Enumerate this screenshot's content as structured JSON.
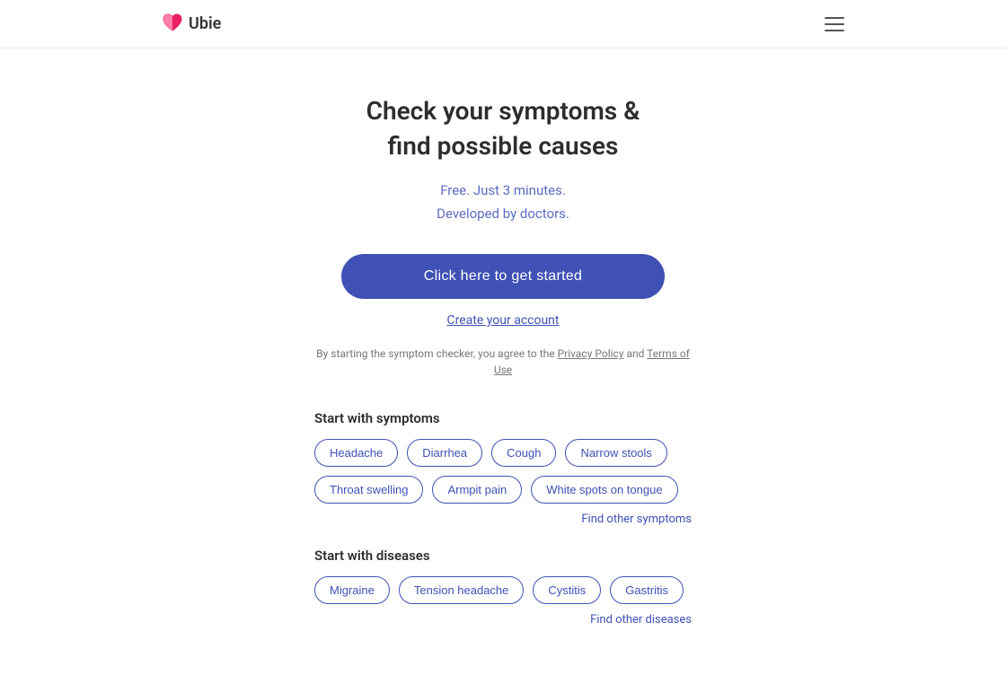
{
  "header": {
    "logo_text": "Ubie",
    "hamburger_label": "Menu"
  },
  "hero": {
    "headline_line1": "Check your symptoms &",
    "headline_line2": "find possible causes",
    "subtext_line1": "Free. Just 3 minutes.",
    "subtext_line2": "Developed by doctors.",
    "cta_label": "Click here to get started",
    "create_account_label": "Create your account",
    "terms_text": "By starting the symptom checker, you agree to the",
    "privacy_policy_label": "Privacy Policy",
    "and_text": "and",
    "terms_of_use_label": "Terms of Use"
  },
  "symptoms_section": {
    "title": "Start with symptoms",
    "pills": [
      {
        "label": "Headache"
      },
      {
        "label": "Diarrhea"
      },
      {
        "label": "Cough"
      },
      {
        "label": "Narrow stools"
      },
      {
        "label": "Throat swelling"
      },
      {
        "label": "Armpit pain"
      },
      {
        "label": "White spots on tongue"
      }
    ],
    "find_other_label": "Find other symptoms"
  },
  "diseases_section": {
    "title": "Start with diseases",
    "pills": [
      {
        "label": "Migraine"
      },
      {
        "label": "Tension headache"
      },
      {
        "label": "Cystitis"
      },
      {
        "label": "Gastritis"
      }
    ],
    "find_other_label": "Find other diseases"
  },
  "icons": {
    "heart": "❤️",
    "hamburger": "☰"
  }
}
